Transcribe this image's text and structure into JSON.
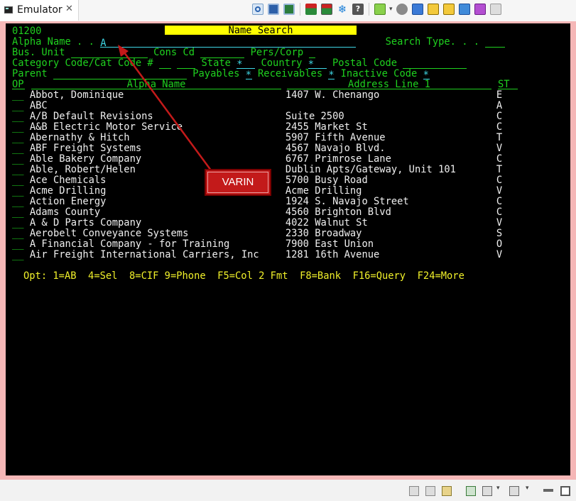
{
  "tab": {
    "title": "Emulator",
    "close": "✕",
    "icon": "terminal-icon"
  },
  "toolbar": {
    "icons": [
      "pin-icon",
      "monitor-icon",
      "monitor-green-icon",
      "grid-red-icon",
      "grid-red-alt-icon",
      "snowflake-icon",
      "help-icon",
      "connect-icon",
      "circle-icon",
      "blue-square-icon",
      "arrow-right-yellow-icon",
      "arrow-left-yellow-icon",
      "arrow-right-blue-icon",
      "arrow-right-magenta-icon",
      "lock-icon"
    ],
    "dropdown": "▾"
  },
  "screen": {
    "program_id": "01200",
    "title": "Name Search",
    "fields": {
      "alpha_name_label": "Alpha Name . . ",
      "alpha_name_value": "A",
      "search_type_label": "Search Type. . .",
      "bus_unit_label": "Bus. Unit",
      "cons_cd_label": "Cons Cd",
      "pers_corp_label": "Pers/Corp",
      "category_label": "Category Code/Cat Code #",
      "state_label": "State",
      "state_value": "*",
      "country_label": "Country",
      "country_value": "*",
      "postal_code_label": "Postal Code",
      "parent_label": "Parent",
      "payables_label": "Payables",
      "payables_value": "*",
      "receivables_label": "Receivables",
      "receivables_value": "*",
      "inactive_code_label": "Inactive Code",
      "inactive_code_value": "*"
    },
    "columns": {
      "op": "OP",
      "alpha_name": "Alpha Name",
      "address": "Address Line 1",
      "st": "ST"
    },
    "rows": [
      {
        "op": "__",
        "name": "Abbot, Dominique",
        "address": "1407 W. Chenango",
        "st": "E"
      },
      {
        "op": "__",
        "name": "ABC",
        "address": "",
        "st": "A"
      },
      {
        "op": "__",
        "name": "A/B Default Revisions",
        "address": "Suite 2500",
        "st": "C"
      },
      {
        "op": "__",
        "name": "A&B Electric Motor Service",
        "address": "2455 Market St",
        "st": "C"
      },
      {
        "op": "__",
        "name": "Abernathy & Hitch",
        "address": "5907 Fifth Avenue",
        "st": "T"
      },
      {
        "op": "__",
        "name": "ABF Freight Systems",
        "address": "4567 Navajo Blvd.",
        "st": "V"
      },
      {
        "op": "__",
        "name": "Able Bakery Company",
        "address": "6767 Primrose Lane",
        "st": "C"
      },
      {
        "op": "__",
        "name": "Able, Robert/Helen",
        "address": "Dublin Apts/Gateway, Unit 101",
        "st": "T"
      },
      {
        "op": "__",
        "name": "Ace Chemicals",
        "address": "5700 Busy Road",
        "st": "C"
      },
      {
        "op": "__",
        "name": "Acme Drilling",
        "address": "Acme Drilling",
        "st": "V"
      },
      {
        "op": "__",
        "name": "Action Energy",
        "address": "1924 S. Navajo Street",
        "st": "C"
      },
      {
        "op": "__",
        "name": "Adams County",
        "address": "4560 Brighton Blvd",
        "st": "C"
      },
      {
        "op": "__",
        "name": "A & D Parts Company",
        "address": "4022 Walnut St",
        "st": "V"
      },
      {
        "op": "__",
        "name": "Aerobelt Conveyance Systems",
        "address": "2330 Broadway",
        "st": "S"
      },
      {
        "op": "__",
        "name": "A Financial Company - for Training",
        "address": "7900 East Union",
        "st": "O"
      },
      {
        "op": "__",
        "name": "Air Freight International Carriers, Inc",
        "address": "1281 16th Avenue",
        "st": "V"
      }
    ],
    "options_line": "Opt: 1=AB  4=Sel  8=CIF 9=Phone  F5=Col 2 Fmt  F8=Bank  F16=Query  F24=More"
  },
  "annotation": {
    "label": "VARIN",
    "color": "#c31a1a"
  },
  "statusbar": {
    "icons": [
      "document-icon",
      "document-edit-icon",
      "document-arrow-icon",
      "view-green-icon",
      "monitor-small-icon",
      "window-icon",
      "minimize-icon",
      "maximize-icon"
    ],
    "dropdown": "▾"
  },
  "colors": {
    "terminal_green": "#1fd11f",
    "terminal_white": "#f0f0f0",
    "terminal_cyan": "#3fd8e6",
    "terminal_yellow": "#f0f02a",
    "frame_pink": "#f5b7b7"
  }
}
